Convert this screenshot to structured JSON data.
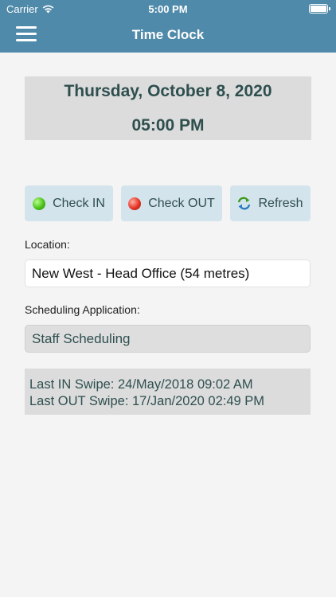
{
  "status_bar": {
    "carrier": "Carrier",
    "time": "5:00 PM"
  },
  "header": {
    "title": "Time Clock"
  },
  "datetime": {
    "date": "Thursday, October 8, 2020",
    "time": "05:00 PM"
  },
  "actions": {
    "check_in": "Check IN",
    "check_out": "Check OUT",
    "refresh": "Refresh"
  },
  "location": {
    "label": "Location:",
    "value": "New West - Head Office (54 metres)"
  },
  "scheduling": {
    "label": "Scheduling Application:",
    "value": "Staff Scheduling"
  },
  "swipes": {
    "last_in": "Last IN Swipe: 24/May/2018 09:02 AM",
    "last_out": "Last OUT Swipe: 17/Jan/2020 02:49 PM"
  },
  "colors": {
    "header_bg": "#4f8aaa",
    "button_bg": "#d4e4ec",
    "panel_bg": "#dcdcdc",
    "check_in_indicator": "#4cc21a",
    "check_out_indicator": "#e53424",
    "refresh_icon": "#3a9a1a"
  },
  "icons": {
    "wifi": "wifi-icon",
    "battery": "battery-icon",
    "menu": "hamburger-menu-icon",
    "check_in": "green-dot-icon",
    "check_out": "red-dot-icon",
    "refresh": "refresh-arrows-icon"
  }
}
